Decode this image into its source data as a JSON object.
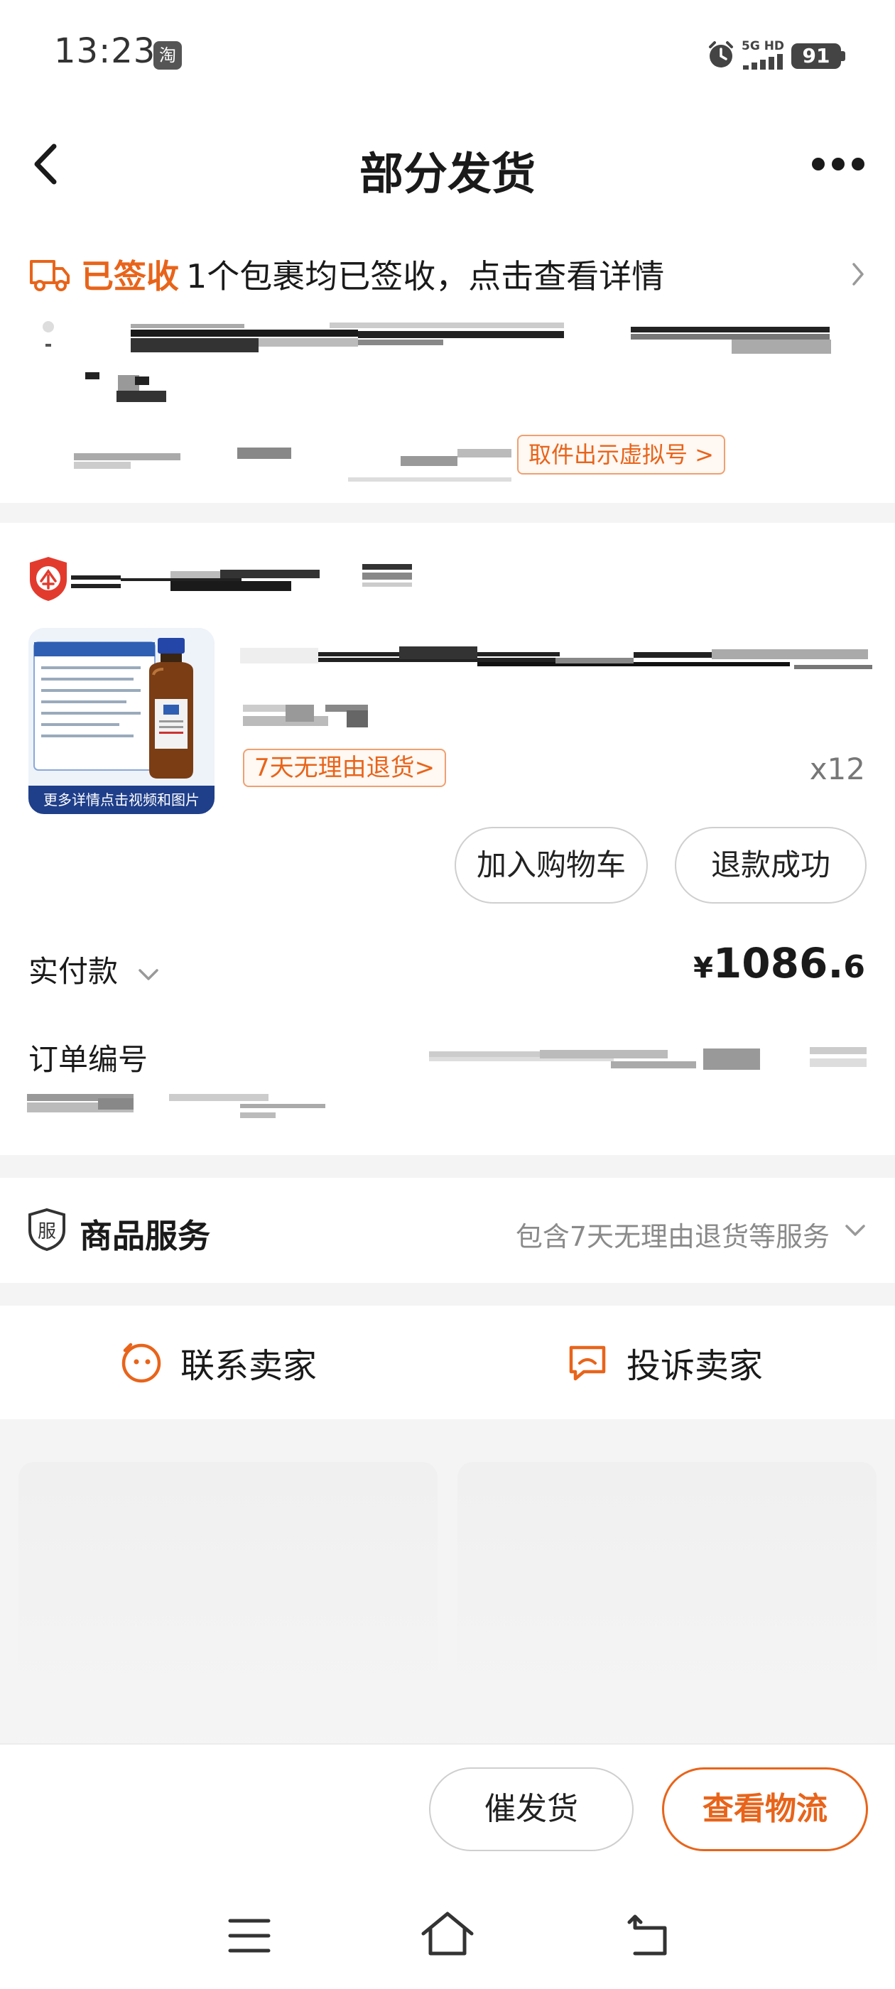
{
  "status_bar": {
    "time": "13:23",
    "app_badge": "淘",
    "network": "5G HD",
    "battery": "91"
  },
  "nav": {
    "title": "部分发货",
    "back_icon": "chevron-left-icon",
    "more_icon": "more-dots-icon"
  },
  "delivery": {
    "status": "已签收",
    "summary": "1个包裹均已签收，点击查看详情",
    "pickup_button": "取件出示虚拟号 >"
  },
  "product": {
    "return_tag": "7天无理由退货>",
    "quantity": "x12",
    "thumb_caption": "更多详情点击视频和图片",
    "add_cart_label": "加入购物车",
    "refund_label": "退款成功",
    "paid_label": "实付款",
    "paid_symbol": "¥",
    "paid_integer": "1086.",
    "paid_decimal": "6",
    "order_label": "订单编号"
  },
  "service": {
    "badge": "服",
    "title": "商品服务",
    "description": "包含7天无理由退货等服务"
  },
  "contact": {
    "contact_label": "联系卖家",
    "complain_label": "投诉卖家"
  },
  "actions": {
    "urge_label": "催发货",
    "logistics_label": "查看物流"
  },
  "colors": {
    "accent": "#e8641a",
    "shield_red": "#e23b2e"
  }
}
